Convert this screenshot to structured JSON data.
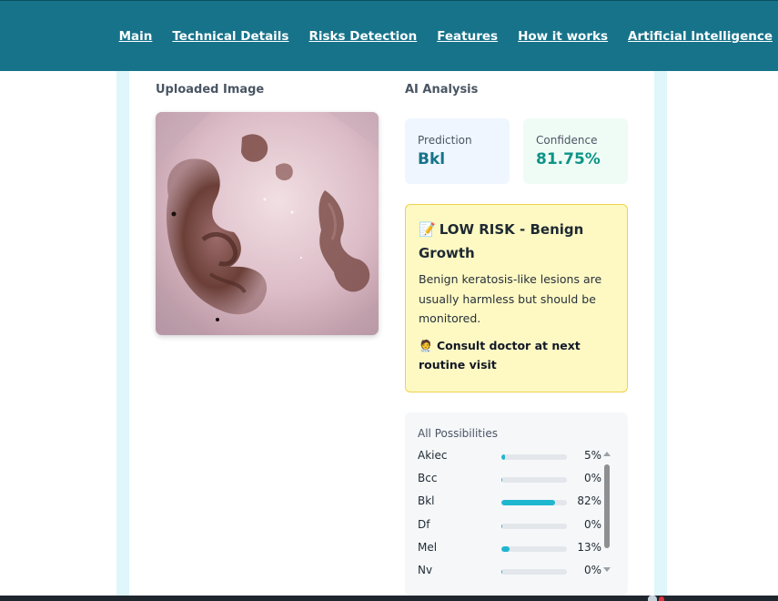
{
  "nav": {
    "items": [
      "Main",
      "Technical Details",
      "Risks Detection",
      "Features",
      "How it works",
      "Artificial Intelligence"
    ]
  },
  "left": {
    "title": "Uploaded Image"
  },
  "right": {
    "title": "AI Analysis"
  },
  "prediction": {
    "label": "Prediction",
    "value": "Bkl",
    "color": "#16738a"
  },
  "confidence": {
    "label": "Confidence",
    "value": "81.75%",
    "color": "#0d9488"
  },
  "risk": {
    "icon": "memo-icon",
    "emoji": "📝",
    "title": "LOW RISK - Benign Growth",
    "description": "Benign keratosis-like lesions are usually harmless but should be monitored.",
    "action_icon": "doctor-icon",
    "action_emoji": "🧑‍⚕️",
    "action": "Consult doctor at next routine visit"
  },
  "possibilities": {
    "title": "All Possibilities",
    "items": [
      {
        "name": "Akiec",
        "percent": 5,
        "label": "5%"
      },
      {
        "name": "Bcc",
        "percent": 0,
        "label": "0%"
      },
      {
        "name": "Bkl",
        "percent": 82,
        "label": "82%"
      },
      {
        "name": "Df",
        "percent": 0,
        "label": "0%"
      },
      {
        "name": "Mel",
        "percent": 13,
        "label": "13%"
      },
      {
        "name": "Nv",
        "percent": 0,
        "label": "0%"
      }
    ]
  },
  "colors": {
    "header": "#16738a",
    "accent_bar": "#1fb6cf",
    "risk_bg": "#fef9c3",
    "risk_border": "#f0d14a"
  }
}
